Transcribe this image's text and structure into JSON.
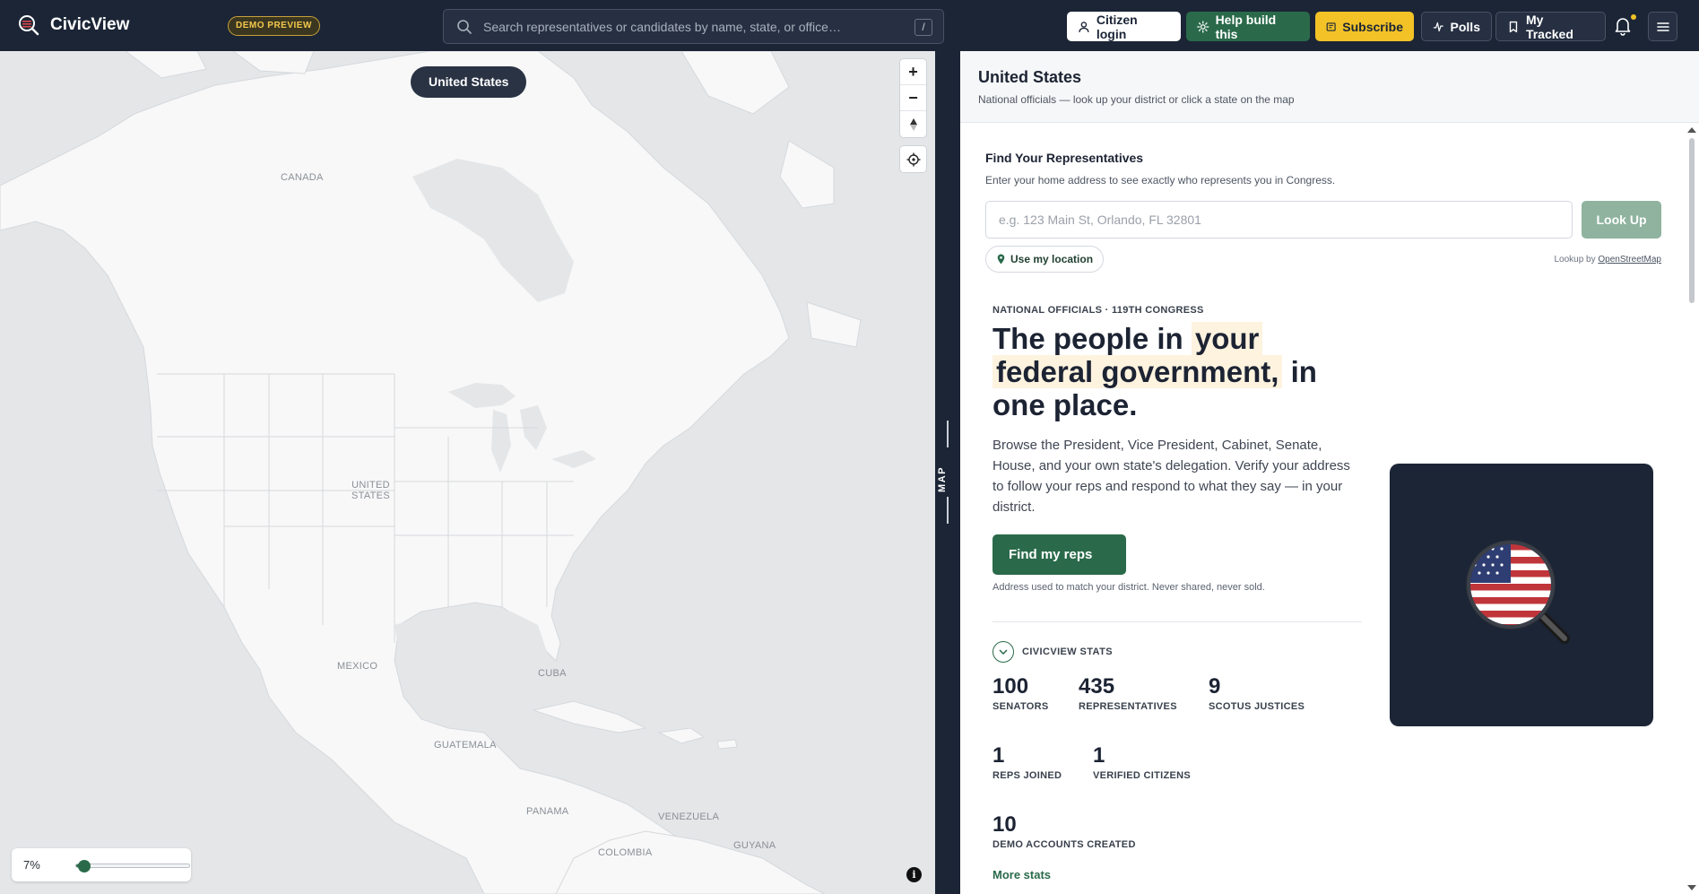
{
  "app": {
    "name": "CivicView",
    "badge": "DEMO PREVIEW"
  },
  "search": {
    "placeholder": "Search representatives or candidates by name, state, or office…",
    "shortcut": "/"
  },
  "nav": {
    "login": "Citizen login",
    "help": "Help build this",
    "subscribe": "Subscribe",
    "polls": "Polls",
    "tracked": "My Tracked"
  },
  "colors": {
    "topbar": "#1b2536",
    "accent_green": "#2a6a4a",
    "accent_yellow": "#f2c227",
    "map_land": "#f8f8f8",
    "map_water": "#e4e6e8"
  },
  "map": {
    "region_pill": "United States",
    "labels": {
      "canada": "CANADA",
      "us_line1": "UNITED",
      "us_line2": "STATES",
      "mexico": "MEXICO",
      "cuba": "CUBA",
      "guatemala": "GUATEMALA",
      "panama": "PANAMA",
      "venezuela": "VENEZUELA",
      "guyana": "GUYANA",
      "colombia": "COLOMBIA"
    },
    "zoom_in": "+",
    "zoom_out": "−",
    "opacity_label": "7%",
    "opacity_value": 0.07,
    "info": "i",
    "toggle_label": "MAP"
  },
  "panel": {
    "title": "United States",
    "subtitle": "National officials — look up your district or click a state on the map",
    "find": {
      "title": "Find Your Representatives",
      "subtitle": "Enter your home address to see exactly who represents you in Congress.",
      "placeholder": "e.g. 123 Main St, Orlando, FL 32801",
      "lookup": "Look Up",
      "use_location": "Use my location",
      "lookup_by": "Lookup by",
      "lookup_by_link": "OpenStreetMap"
    },
    "hero": {
      "eyebrow": "NATIONAL OFFICIALS · 119TH CONGRESS",
      "line_a": "The people in ",
      "hl_a": "your",
      "hl_b": "federal government,",
      "line_b": " in one place.",
      "description": "Browse the President, Vice President, Cabinet, Senate, House, and your own state's delegation. Verify your address to follow your reps and respond to what they say — in your district.",
      "cta": "Find my reps",
      "privacy": "Address used to match your district. Never shared, never sold."
    },
    "stats": {
      "title": "CIVICVIEW STATS",
      "items": [
        {
          "value": "100",
          "label": "SENATORS"
        },
        {
          "value": "435",
          "label": "REPRESENTATIVES"
        },
        {
          "value": "9",
          "label": "SCOTUS JUSTICES"
        },
        {
          "value": "1",
          "label": "REPS JOINED"
        },
        {
          "value": "1",
          "label": "VERIFIED CITIZENS"
        },
        {
          "value": "10",
          "label": "DEMO ACCOUNTS CREATED"
        }
      ],
      "more": "More stats"
    }
  }
}
